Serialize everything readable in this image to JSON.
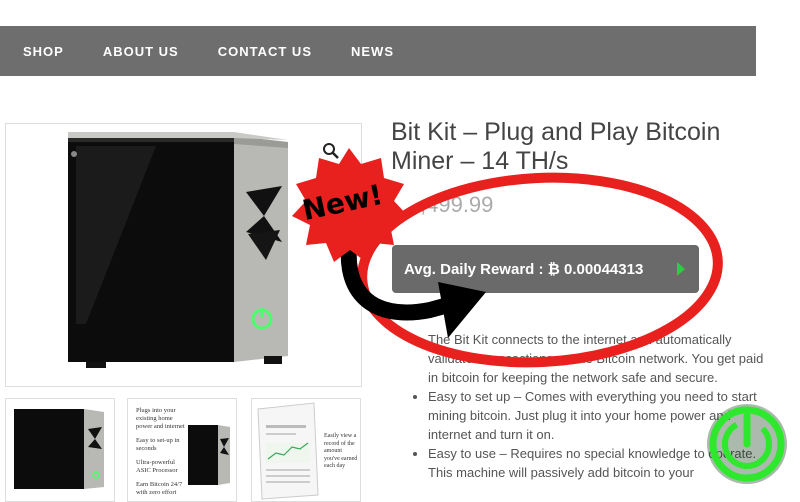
{
  "nav": {
    "items": [
      "SHOP",
      "ABOUT US",
      "CONTACT US",
      "NEWS"
    ]
  },
  "product": {
    "title": "Bit Kit – Plug and Play Bitcoin Miner – 14 TH/s",
    "price": ",499.99",
    "reward_label": "Avg. Daily Reward : ₿ 0.00044313",
    "features": [
      "The Bit Kit connects to the internet and automatically validates transactions on the Bitcoin network. You get paid in bitcoin for keeping the network safe and secure.",
      "Easy to set up – Comes with everything you need to start mining bitcoin. Just plug it into your home power and internet and turn it on.",
      "Easy to use – Requires no special knowledge to operate. This machine will passively add bitcoin to your"
    ]
  },
  "thumbs": {
    "t2": [
      "Plugs into your existing home power and internet",
      "Easy to set-up in seconds",
      "Ultra-powerful ASIC Processor",
      "Earn Bitcoin 24/7 with zero effort"
    ],
    "t3": [
      "Easily view a record of the amount you've earned each day"
    ]
  },
  "badge": {
    "text": "New!"
  },
  "colors": {
    "nav_bg": "#6e6e6e",
    "reward_bg": "#6a6a6a",
    "badge_red": "#e8201e",
    "power_green": "#2ee82e",
    "arrow_green": "#2ecc40"
  }
}
